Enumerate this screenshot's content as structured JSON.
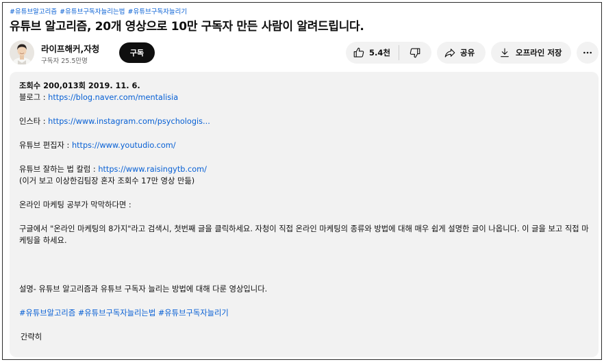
{
  "video": {
    "hashtags": [
      "#유튜브알고리즘",
      "#유튜브구독자늘리는법",
      "#유튜브구독자늘리기"
    ],
    "title": "유튜브 알고리즘, 20개 영상으로 10만 구독자 만든 사람이 알려드립니다."
  },
  "channel": {
    "name": "라이프해커,자청",
    "subscribers": "구독자 25.5만명",
    "subscribe_label": "구독"
  },
  "actions": {
    "like_count": "5.4천",
    "share_label": "공유",
    "offline_label": "오프라인 저장"
  },
  "description": {
    "stats": "조회수 200,013회  2019. 11. 6.",
    "blog_label": "블로그 : ",
    "blog_url": "https://blog.naver.com/mentalisia",
    "insta_label": "인스타 : ",
    "insta_url": "https://www.instagram.com/psychologis...",
    "editor_label": "유튜브 편집자 : ",
    "editor_url": "https://www.youtudio.com/",
    "column_label": "유튜브 잘하는 법 칼럼 : ",
    "column_url": "https://www.raisingytb.com/",
    "column_note": "(이거 보고 이상한김팀장 혼자 조회수 17만 영상 만듦)",
    "marketing_intro": "온라인 마케팅 공부가 막막하다면 :",
    "marketing_text": "구글에서 \"온라인 마케팅의 8가지\"라고 검색시, 첫번째 글을 클릭하세요. 자청이 직접 온라인 마케팅의 종류와 방법에 대해 매우 쉽게 설명한 글이 나옵니다. 이 글을 보고 직접 마케팅을 하세요.",
    "summary": "설명- 유튜브 알고리즘과 유튜브 구독자 늘리는 방법에 대해 다룬 영상입니다.",
    "hashtags": [
      "#유튜브알고리즘",
      "#유튜브구독자늘리는법",
      "#유튜브구독자늘리기"
    ],
    "collapse_label": "간략히"
  },
  "icons": [
    "thumbs-up-icon",
    "thumbs-down-icon",
    "share-icon",
    "download-icon",
    "more-icon"
  ]
}
